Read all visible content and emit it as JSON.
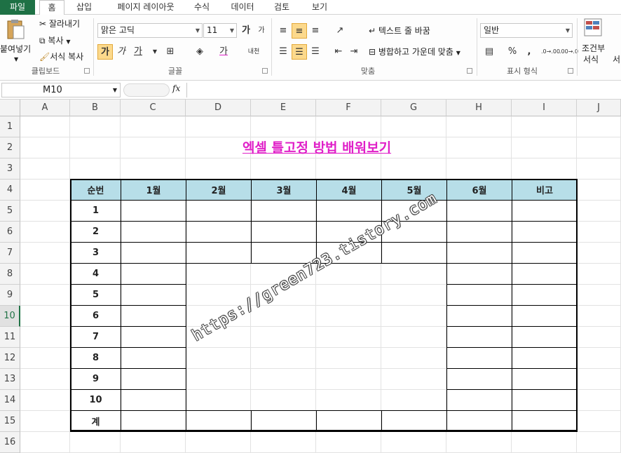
{
  "tabs": [
    "파일",
    "홈",
    "삽입",
    "페이지 레이아웃",
    "수식",
    "데이터",
    "검토",
    "보기"
  ],
  "clipboard": {
    "paste": "붙여넣기",
    "cut": "잘라내기",
    "copy": "복사",
    "painter": "서식 복사",
    "label": "클립보드"
  },
  "font": {
    "name": "맑은 고딕",
    "size": "11",
    "grow": "가",
    "shrink": "가",
    "bold": "가",
    "italic": "가",
    "underline": "가",
    "color_btn": "가",
    "phonetic": "내천",
    "label": "글꼴"
  },
  "align": {
    "wrap": "텍스트 줄 바꿈",
    "merge": "병합하고 가운데 맞춤",
    "label": "맞춤"
  },
  "number": {
    "format": "일반",
    "percent": "%",
    "comma": ",",
    "inc": ".0→.00",
    "dec": ".00→.0",
    "label": "표시 형식"
  },
  "styles": {
    "cond_l1": "조건부",
    "cond_l2": "서식",
    "cut_off": "서"
  },
  "namebox": {
    "value": "M10"
  },
  "fx": "fx",
  "columns": [
    "A",
    "B",
    "C",
    "D",
    "E",
    "F",
    "G",
    "H",
    "I",
    "J"
  ],
  "rows": [
    "1",
    "2",
    "3",
    "4",
    "5",
    "6",
    "7",
    "8",
    "9",
    "10",
    "11",
    "12",
    "13",
    "14",
    "15",
    "16"
  ],
  "sheet_title": "엑셀 틀고정 방법 배워보기",
  "table": {
    "headers": [
      "순번",
      "1월",
      "2월",
      "3월",
      "4월",
      "5월",
      "6월",
      "비고"
    ],
    "row_labels": [
      "1",
      "2",
      "3",
      "4",
      "5",
      "6",
      "7",
      "8",
      "9",
      "10",
      "계"
    ]
  },
  "watermark": "https://green723.tistory.com",
  "colors": {
    "accent": "#217346",
    "file_tab": "#1e7145",
    "title": "#e020c8",
    "header_fill": "#b7dee8",
    "selected": "#fcd98c"
  }
}
